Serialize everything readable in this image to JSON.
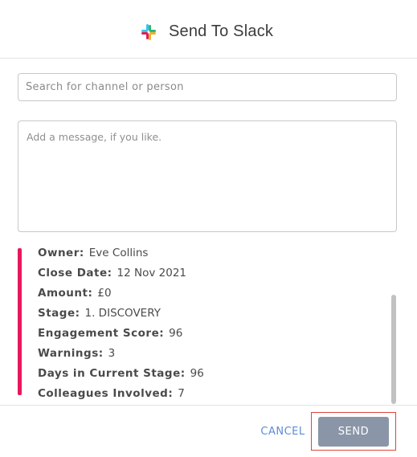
{
  "header": {
    "title": "Send To Slack",
    "icon": "slack-logo-icon"
  },
  "search": {
    "placeholder": "Search for channel or person",
    "value": ""
  },
  "message": {
    "placeholder": "Add a message, if you like.",
    "value": ""
  },
  "details": {
    "accent_color": "#e8175d",
    "rows": [
      {
        "label": "Owner:",
        "value": "Eve Collins"
      },
      {
        "label": "Close Date:",
        "value": "12 Nov 2021"
      },
      {
        "label": "Amount:",
        "value": "£0"
      },
      {
        "label": "Stage:",
        "value": "1. DISCOVERY"
      },
      {
        "label": "Engagement Score:",
        "value": "96"
      },
      {
        "label": "Warnings:",
        "value": "3"
      },
      {
        "label": "Days in Current Stage:",
        "value": "96"
      },
      {
        "label": "Colleagues Involved:",
        "value": "7"
      }
    ]
  },
  "footer": {
    "cancel_label": "CANCEL",
    "send_label": "SEND",
    "cancel_color": "#5b8dd6",
    "send_bg": "#8a96a8"
  }
}
